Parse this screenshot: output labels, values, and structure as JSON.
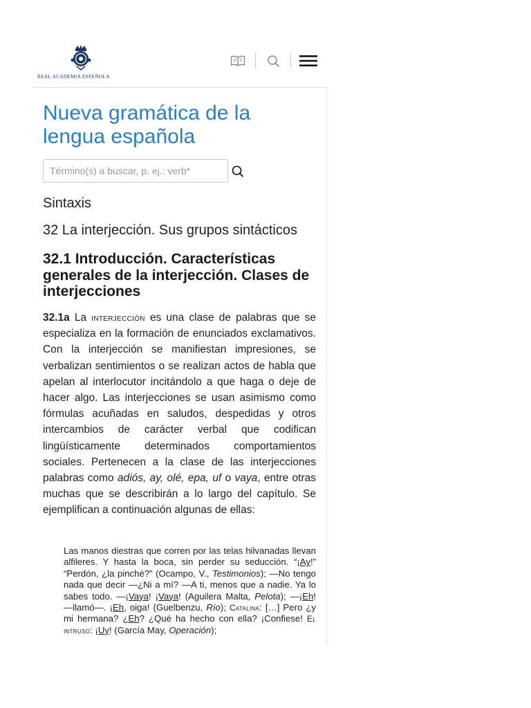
{
  "header": {
    "logo_text": "REAL ACADEMIA ESPAÑOLA",
    "icons": [
      "book-icon",
      "search-icon",
      "menu-icon"
    ],
    "brand_color": "#1c3966"
  },
  "main": {
    "title": "Nueva gramática de la lengua española",
    "search_placeholder": "Término(s) a buscar, p. ej.: verb*",
    "search_value": "",
    "section": "Sintaxis",
    "chapter": "32 La interjección. Sus grupos sintácticos",
    "subsection": "32.1 Introducción. Características generales de la interjección. Clases de interjecciones",
    "title_color": "#2a7fc4"
  },
  "paragraph": {
    "number": "32.1a",
    "t1": " La ",
    "term": "interjección",
    "t2": " es una clase de palabras que se especializa en la formación de enunciados exclamativos. Con la interjección se manifiestan impresiones, se verbalizan sentimientos o se realizan actos de habla que apelan al interlocutor incitándolo a que haga o deje de hacer algo. Las interjecciones se usan asimismo como fórmulas acuñadas en saludos, despedidas y otros intercambios de carácter verbal que codifican lingüísticamente determinados comportamientos sociales. Pertenecen a la clase de las interjecciones palabras como ",
    "examples": "adiós, ay, olé, epa, uf",
    "t3": " o ",
    "ex_vaya": "vaya",
    "t4": ", entre otras muchas que se describirán a lo largo del capítulo. Se ejemplifican a continuación algunas de ellas:"
  },
  "quote": {
    "q1": "Las manos diestras que corren por las telas hilvanadas llevan alfileres. Y hasta la boca, sin perder su seducción. “¡",
    "q_ay": "Ay",
    "q2": "!” “Perdón, ¿la pinché?” (Ocampo, V., ",
    "q_testimonios": "Testimonios",
    "q3": "); —No tengo nada que decir —¿Ni a mí? —A ti, menos que a nadie. Ya lo sabes todo. —¡",
    "q_vaya1": "Vaya",
    "q4": "! ¡",
    "q_vaya2": "Vaya",
    "q5": "! (Aguilera Malta, ",
    "q_pelota": "Pelota",
    "q6": "); —¡",
    "q_eh1": "Eh",
    "q7": "! —llamó—. ¡",
    "q_eh2": "Eh",
    "q8": ", oiga! (Guelbenzu, ",
    "q_rio": "Río",
    "q9": "); ",
    "q_catalina": "Catalina",
    "q10": ": […] Pero ¿y mi hermana? ¿",
    "q_eh3": "Eh",
    "q11": "? ¿Qué ha hecho con ella? ¡Confiese! ",
    "q_intruso": "El intruso",
    "q12": ": ¡",
    "q_uy": "Uy",
    "q13": "! (García May, ",
    "q_operacion": "Operación",
    "q14": ");"
  }
}
